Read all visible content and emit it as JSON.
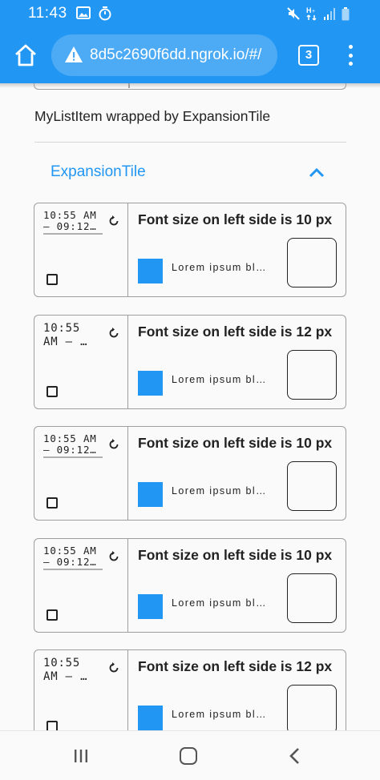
{
  "status_bar": {
    "time": "11:43",
    "left_icons": [
      "image-icon",
      "timer-icon"
    ],
    "right_icons": [
      "mute-icon",
      "signal-h-icon",
      "cellular-signal-icon",
      "battery-icon"
    ]
  },
  "browser": {
    "url": "8d5c2690f6dd.ngrok.io/#/",
    "tab_count": "3",
    "accent": "#2196f3"
  },
  "page": {
    "section_label": "MyListItem wrapped by ExpansionTile",
    "expansion_title": "ExpansionTile",
    "expansion_expanded": true,
    "accent_color": "#2196f3",
    "items": [
      {
        "time_line1": "10:55 AM",
        "time_line2": "— 09:12…",
        "title": "Font size on left side is 10 px",
        "text": "Lorem ipsum bl…",
        "checked": false
      },
      {
        "time_line1": "10:55",
        "time_line2": "AM — …",
        "title": "Font size on left side is 12 px",
        "text": "Lorem ipsum bl…",
        "checked": false
      },
      {
        "time_line1": "10:55 AM",
        "time_line2": "— 09:12…",
        "title": "Font size on left side is 10 px",
        "text": "Lorem ipsum bl…",
        "checked": false
      },
      {
        "time_line1": "10:55 AM",
        "time_line2": "— 09:12…",
        "title": "Font size on left side is 10 px",
        "text": "Lorem ipsum bl…",
        "checked": false
      },
      {
        "time_line1": "10:55",
        "time_line2": "AM — …",
        "title": "Font size on left side is 12 px",
        "text": "Lorem ipsum bl…",
        "checked": false
      }
    ]
  },
  "nav_bar": {
    "buttons": [
      "recent-apps-icon",
      "home-icon",
      "back-icon"
    ]
  }
}
